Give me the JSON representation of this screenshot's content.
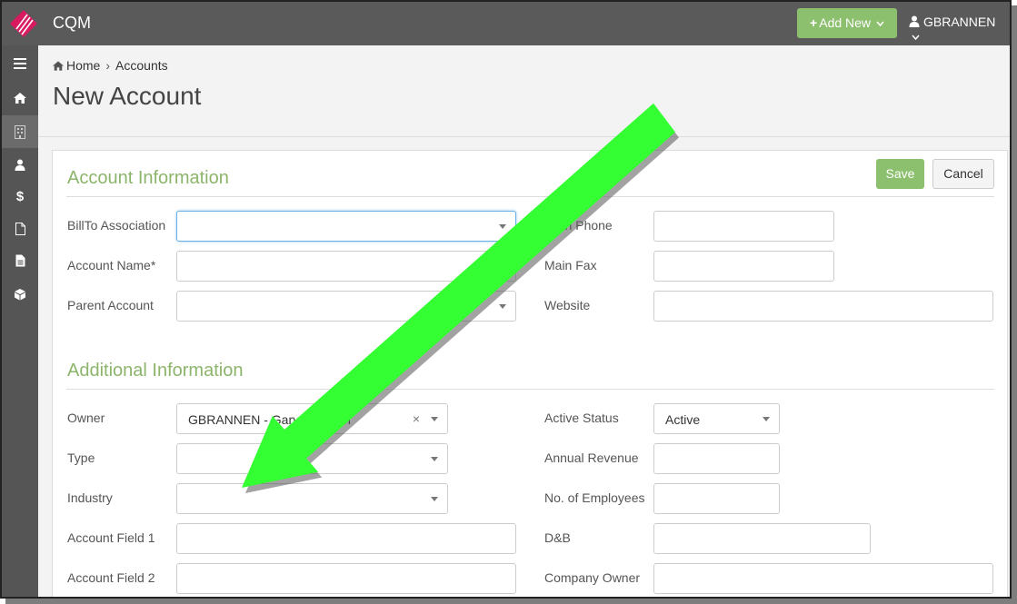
{
  "topbar": {
    "app_name": "CQM",
    "add_new_label": "Add New",
    "user_name": "GBRANNEN"
  },
  "sidebar": {
    "items": [
      {
        "icon": "menu-icon"
      },
      {
        "icon": "home-icon"
      },
      {
        "icon": "building-icon"
      },
      {
        "icon": "user-icon"
      },
      {
        "icon": "dollar-icon"
      },
      {
        "icon": "file-icon"
      },
      {
        "icon": "document-icon"
      },
      {
        "icon": "cube-icon"
      }
    ]
  },
  "breadcrumb": {
    "home": "Home",
    "current": "Accounts"
  },
  "page_title": "New Account",
  "actions": {
    "save": "Save",
    "cancel": "Cancel"
  },
  "account_info": {
    "title": "Account Information",
    "bill_to_label": "BillTo Association",
    "account_name_label": "Account Name*",
    "parent_account_label": "Parent Account",
    "main_phone_label": "Main Phone",
    "main_fax_label": "Main Fax",
    "website_label": "Website"
  },
  "additional_info": {
    "title": "Additional Information",
    "owner_label": "Owner",
    "owner_value": "GBRANNEN - Gary Brannen",
    "type_label": "Type",
    "industry_label": "Industry",
    "field1_label": "Account Field 1",
    "field2_label": "Account Field 2",
    "active_status_label": "Active Status",
    "active_status_value": "Active",
    "annual_revenue_label": "Annual Revenue",
    "employees_label": "No. of Employees",
    "dnb_label": "D&B",
    "company_owner_label": "Company Owner"
  },
  "colors": {
    "accent_green": "#8cbf6e",
    "section_title": "#8cb56b",
    "annotation_arrow": "#33ff33"
  }
}
